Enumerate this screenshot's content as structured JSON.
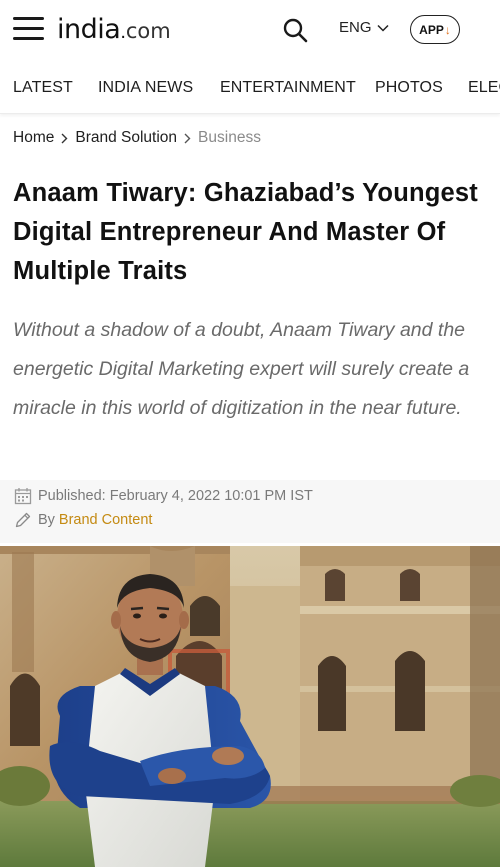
{
  "header": {
    "logo_main": "india",
    "logo_dot": ".",
    "logo_suffix": "com",
    "language": "ENG",
    "app_label": "APP",
    "app_arrow": "↓"
  },
  "nav": {
    "items": [
      "LATEST",
      "INDIA NEWS",
      "ENTERTAINMENT",
      "PHOTOS",
      "ELEC"
    ]
  },
  "breadcrumb": {
    "items": [
      "Home",
      "Brand Solution"
    ],
    "current": "Business"
  },
  "article": {
    "title": "Anaam Tiwary: Ghaziabad’s Youngest Digital Entrepreneur And Master Of Multiple Traits",
    "summary": "Without a shadow of a doubt, Anaam Tiwary and the energetic Digital Marketing expert will surely create a miracle in this world of digitization in the near future.",
    "published": "Published: February 4, 2022 10:01 PM IST",
    "by_label": "By",
    "author": "Brand Content"
  },
  "colors": {
    "author_link": "#c48a12",
    "app_arrow": "#e0701c",
    "summary_text": "#6a6a6a",
    "meta_bg": "#f7f7f7"
  },
  "icons": {
    "menu": "hamburger-menu-icon",
    "search": "search-icon",
    "chevron": "chevron-down-icon",
    "calendar": "calendar-icon",
    "pencil": "pencil-icon"
  }
}
